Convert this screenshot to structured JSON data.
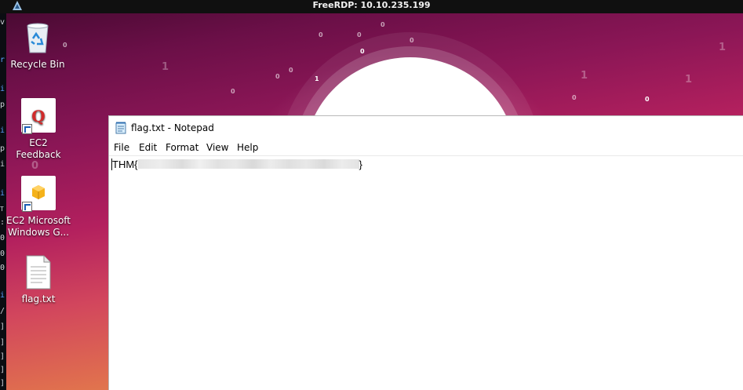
{
  "rdp": {
    "title": "FreeRDP: 10.10.235.199",
    "logo_icon": "freerdp-logo-icon"
  },
  "terminal_fragments": [
    "v",
    "r",
    "i",
    "p",
    "i",
    "p",
    "i",
    "i",
    "T",
    ":",
    "0",
    "0",
    "0",
    "i",
    "/",
    "]",
    "]",
    "]",
    "]",
    "]"
  ],
  "desktop": {
    "background": {
      "top": "#5a0c3c",
      "middle": "#c2335e",
      "bottom": "#eab04a"
    },
    "digits": [
      "0",
      "0",
      "0",
      "0",
      "0",
      "1",
      "1",
      "0",
      "0",
      "1",
      "1",
      "1",
      "0",
      "0",
      "0",
      "1",
      "0",
      "0"
    ],
    "icons": [
      {
        "label": "Recycle Bin",
        "icon": "recycle-bin-icon",
        "shortcut": false
      },
      {
        "label": "EC2 Feedback",
        "icon": "ec2-feedback-icon",
        "shortcut": true
      },
      {
        "label": "EC2 Microsoft Windows G...",
        "label_line1": "EC2 Microsoft",
        "label_line2": "Windows G...",
        "icon": "ec2-windows-guide-icon",
        "shortcut": true
      },
      {
        "label": "flag.txt",
        "icon": "text-file-icon",
        "shortcut": false
      }
    ]
  },
  "notepad": {
    "title": "flag.txt - Notepad",
    "icon": "notepad-icon",
    "menu": [
      "File",
      "Edit",
      "Format",
      "View",
      "Help"
    ],
    "content_prefix": "THM{",
    "content_suffix": "}"
  }
}
